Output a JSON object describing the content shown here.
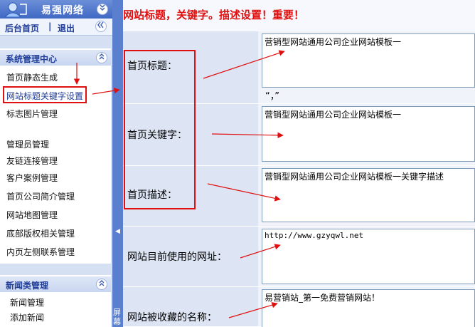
{
  "sidebar": {
    "brand": {
      "title": "易强网络",
      "collapse_icon": "double-chevron-down-icon"
    },
    "topnav": {
      "home": "后台首页",
      "separator": "|",
      "logout": "退出",
      "toggle_icon": "double-chevron-left-icon"
    },
    "system_group": {
      "title": "系统管理中心",
      "toggle_icon": "double-chevron-up-icon",
      "items": [
        {
          "label": "首页静态生成"
        },
        {
          "label": "网站标题关键字设置",
          "active": true
        },
        {
          "label": "标志图片管理"
        },
        {
          "label": "管理员管理"
        },
        {
          "label": "友链连接管理"
        },
        {
          "label": "客户案例管理"
        },
        {
          "label": "首页公司简介管理"
        },
        {
          "label": "网站地图管理"
        },
        {
          "label": "底部版权相关管理"
        },
        {
          "label": "内页左侧联系管理"
        }
      ]
    },
    "news_group": {
      "title": "新闻类管理",
      "toggle_icon": "double-chevron-up-icon",
      "items": [
        {
          "label": "新闻管理"
        },
        {
          "label": "添加新闻"
        }
      ]
    },
    "splitter_text": "屏幕"
  },
  "main": {
    "title": "网站标题，关键字。描述设置！重要！",
    "form": {
      "home_title": {
        "label": "首页标题：",
        "value": "营销型网站通用公司企业网站模板一",
        "note": "“，”"
      },
      "home_keywords": {
        "label": "首页关键字：",
        "value": "营销型网站通用公司企业网站模板一"
      },
      "home_description": {
        "label": "首页描述：",
        "value": "营销型网站通用公司企业网站模板一关键字描述"
      },
      "site_url": {
        "label": "网站目前使用的网址：",
        "value": "http://www.gzyqwl.net"
      },
      "favorite_name": {
        "label": "网站被收藏的名称：",
        "value": "易营销站_第一免费营销网站！"
      }
    }
  },
  "colors": {
    "annotation": "#e01010",
    "brand_bar": "#4068c4",
    "label_bg": "#dde4f3",
    "nav_text": "#1f3c99"
  }
}
